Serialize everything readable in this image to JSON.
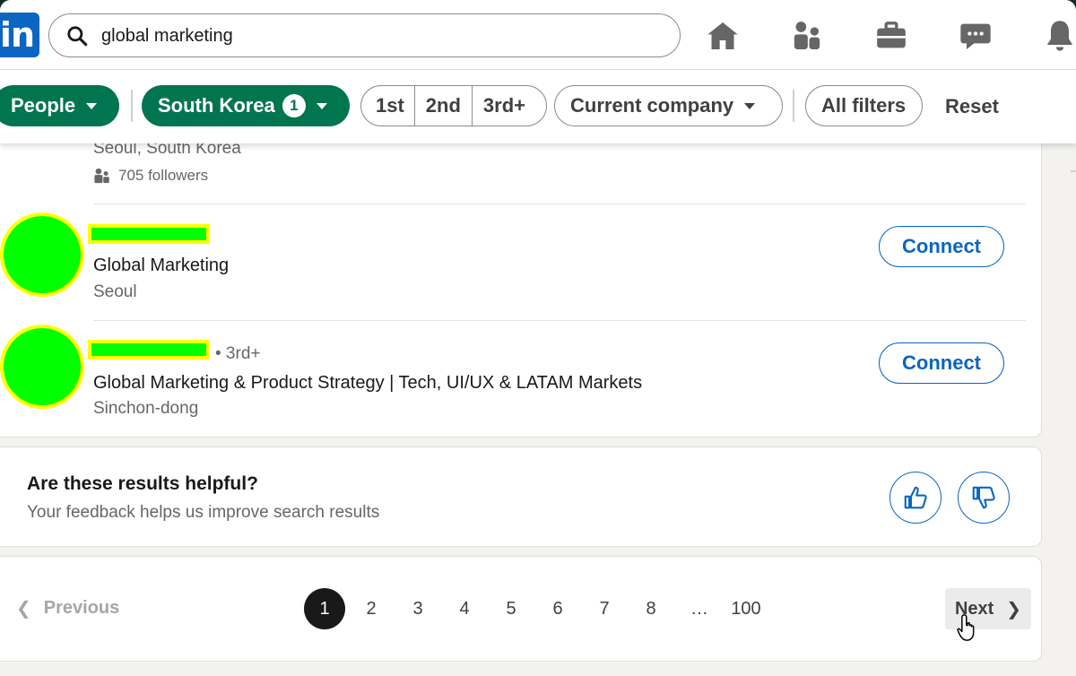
{
  "search": {
    "value": "global marketing",
    "placeholder": "Search"
  },
  "nav_icons": [
    "home-icon",
    "my-network-icon",
    "jobs-icon",
    "messaging-icon",
    "notifications-icon"
  ],
  "logo_text": "in",
  "filters": {
    "people": "People",
    "location": "South Korea",
    "location_count": "1",
    "degrees": [
      "1st",
      "2nd",
      "3rd+"
    ],
    "current_company": "Current company",
    "all_filters": "All filters",
    "reset": "Reset"
  },
  "results": {
    "partial_top": {
      "location": "Seoul, South Korea",
      "followers": "705 followers"
    },
    "items": [
      {
        "degree": "",
        "headline": "Global Marketing",
        "location": "Seoul",
        "action": "Connect"
      },
      {
        "degree": "• 3rd+",
        "headline": "Global Marketing & Product Strategy | Tech, UI/UX & LATAM Markets",
        "location": "Sinchon-dong",
        "action": "Connect"
      }
    ]
  },
  "feedback": {
    "title": "Are these results helpful?",
    "subtitle": "Your feedback helps us improve search results"
  },
  "pagination": {
    "previous": "Previous",
    "pages": [
      "1",
      "2",
      "3",
      "4",
      "5",
      "6",
      "7",
      "8",
      "…",
      "100"
    ],
    "current": "1",
    "next": "Next"
  },
  "colors": {
    "brand_blue": "#0a66c2",
    "filter_green": "#01754f",
    "redaction_fill": "#00ff00",
    "redaction_border": "#ffff00"
  }
}
